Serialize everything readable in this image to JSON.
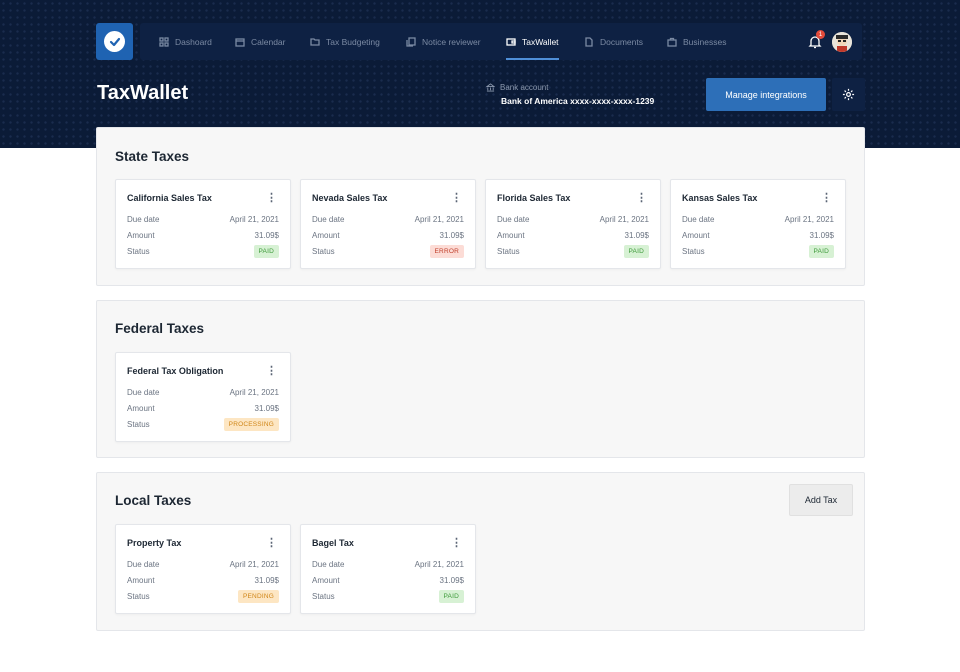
{
  "nav": {
    "items": [
      {
        "label": "Dashoard",
        "icon": "grid-icon"
      },
      {
        "label": "Calendar",
        "icon": "calendar-icon"
      },
      {
        "label": "Tax Budgeting",
        "icon": "folder-icon"
      },
      {
        "label": "Notice reviewer",
        "icon": "copy-icon"
      },
      {
        "label": "TaxWallet",
        "icon": "wallet-icon",
        "active": true
      },
      {
        "label": "Documents",
        "icon": "document-icon"
      },
      {
        "label": "Businesses",
        "icon": "briefcase-icon"
      }
    ],
    "notification_count": "1"
  },
  "header": {
    "title": "TaxWallet",
    "bank_label": "Bank account",
    "bank_value": "Bank of America xxxx-xxxx-xxxx-1239",
    "manage_label": "Manage integrations"
  },
  "labels": {
    "due": "Due date",
    "amount": "Amount",
    "status": "Status"
  },
  "sections": [
    {
      "title": "State Taxes",
      "cards": [
        {
          "name": "California Sales Tax",
          "due": "April 21, 2021",
          "amount": "31.09$",
          "status": "PAID"
        },
        {
          "name": "Nevada Sales Tax",
          "due": "April 21, 2021",
          "amount": "31.09$",
          "status": "ERROR"
        },
        {
          "name": "Florida Sales Tax",
          "due": "April 21, 2021",
          "amount": "31.09$",
          "status": "PAID"
        },
        {
          "name": "Kansas Sales Tax",
          "due": "April 21, 2021",
          "amount": "31.09$",
          "status": "PAID"
        }
      ]
    },
    {
      "title": "Federal Taxes",
      "cards": [
        {
          "name": "Federal Tax Obligation",
          "due": "April 21, 2021",
          "amount": "31.09$",
          "status": "PROCESSING"
        }
      ]
    },
    {
      "title": "Local Taxes",
      "add_label": "Add Tax",
      "cards": [
        {
          "name": "Property Tax",
          "due": "April 21, 2021",
          "amount": "31.09$",
          "status": "PENDING"
        },
        {
          "name": "Bagel Tax",
          "due": "April 21, 2021",
          "amount": "31.09$",
          "status": "PAID"
        }
      ]
    }
  ],
  "colors": {
    "accent": "#2d6fb8",
    "header_bg": "#0b1b37",
    "paid": "#3e9a3a",
    "error": "#c13e2a",
    "pending": "#d08618"
  }
}
